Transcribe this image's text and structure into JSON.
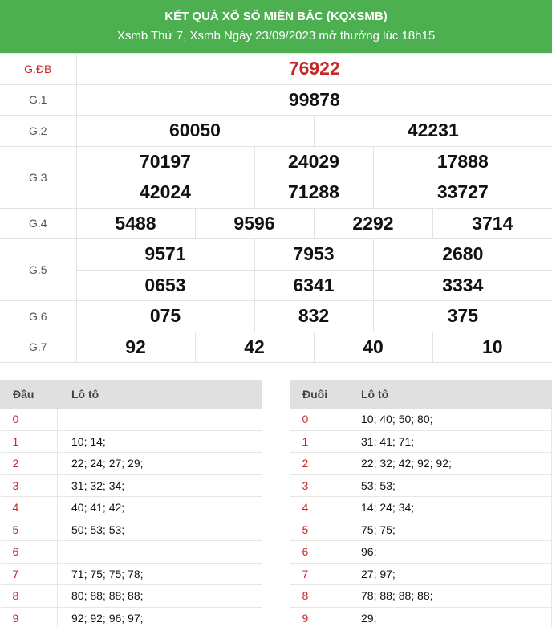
{
  "header": {
    "title": "KẾT QUẢ XỔ SỐ MIỀN BẮC (KQXSMB)",
    "subtitle": "Xsmb Thứ 7, Xsmb Ngày 23/09/2023 mở thưởng lúc 18h15"
  },
  "results": {
    "gdb": {
      "label": "G.ĐB",
      "numbers": [
        "76922"
      ]
    },
    "g1": {
      "label": "G.1",
      "numbers": [
        "99878"
      ]
    },
    "g2": {
      "label": "G.2",
      "numbers": [
        "60050",
        "42231"
      ]
    },
    "g3": {
      "label": "G.3",
      "numbers": [
        "70197",
        "24029",
        "17888",
        "42024",
        "71288",
        "33727"
      ]
    },
    "g4": {
      "label": "G.4",
      "numbers": [
        "5488",
        "9596",
        "2292",
        "3714"
      ]
    },
    "g5": {
      "label": "G.5",
      "numbers": [
        "9571",
        "7953",
        "2680",
        "0653",
        "6341",
        "3334"
      ]
    },
    "g6": {
      "label": "G.6",
      "numbers": [
        "075",
        "832",
        "375"
      ]
    },
    "g7": {
      "label": "G.7",
      "numbers": [
        "92",
        "42",
        "40",
        "10"
      ]
    }
  },
  "loto_dau": {
    "head1": "Đầu",
    "head2": "Lô tô",
    "rows": [
      {
        "k": "0",
        "v": ""
      },
      {
        "k": "1",
        "v": "10; 14;"
      },
      {
        "k": "2",
        "v": "22; 24; 27; 29;"
      },
      {
        "k": "3",
        "v": "31; 32; 34;"
      },
      {
        "k": "4",
        "v": "40; 41; 42;"
      },
      {
        "k": "5",
        "v": "50; 53; 53;"
      },
      {
        "k": "6",
        "v": ""
      },
      {
        "k": "7",
        "v": "71; 75; 75; 78;"
      },
      {
        "k": "8",
        "v": "80; 88; 88; 88;"
      },
      {
        "k": "9",
        "v": "92; 92; 96; 97;"
      }
    ]
  },
  "loto_duoi": {
    "head1": "Đuôi",
    "head2": "Lô tô",
    "rows": [
      {
        "k": "0",
        "v": "10; 40; 50; 80;"
      },
      {
        "k": "1",
        "v": "31; 41; 71;"
      },
      {
        "k": "2",
        "v": "22; 32; 42; 92; 92;"
      },
      {
        "k": "3",
        "v": "53; 53;"
      },
      {
        "k": "4",
        "v": "14; 24; 34;"
      },
      {
        "k": "5",
        "v": "75; 75;"
      },
      {
        "k": "6",
        "v": "96;"
      },
      {
        "k": "7",
        "v": "27; 97;"
      },
      {
        "k": "8",
        "v": "78; 88; 88; 88;"
      },
      {
        "k": "9",
        "v": "29;"
      }
    ]
  }
}
